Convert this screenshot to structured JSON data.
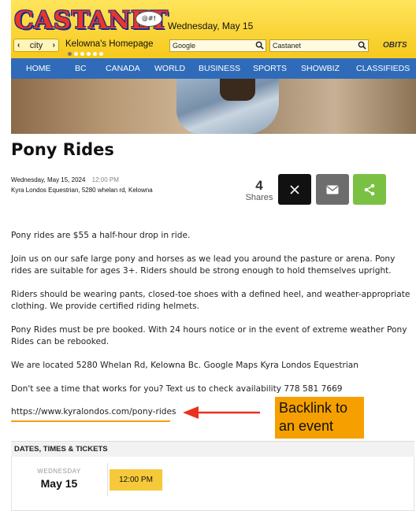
{
  "header": {
    "logo_text": "CASTANET",
    "logo_bubble_text": "@#!",
    "date": "Wednesday, May 15",
    "city_label": "city",
    "home_label": "Kelowna's Homepage",
    "search_google_value": "Google",
    "search_castanet_value": "Castanet",
    "obits_label": "OBITS"
  },
  "nav": {
    "items": [
      "HOME",
      "BC",
      "CANADA",
      "WORLD",
      "BUSINESS",
      "SPORTS",
      "SHOWBIZ",
      "CLASSIFIEDS"
    ]
  },
  "article": {
    "title": "Pony Rides",
    "date": "Wednesday, May 15, 2024",
    "time": "12:00 PM",
    "location": "Kyra Londos Equestrian, 5280 whelan rd, Kelowna",
    "shares_count": "4",
    "shares_label": "Shares",
    "paragraphs": [
      "Pony rides are $55 a half-hour drop in ride.",
      "Join us on our safe large pony and horses as we lead you around the pasture or arena. Pony rides are suitable for ages 3+. Riders should be strong enough to hold themselves upright.",
      "Riders should be wearing pants, closed-toe shoes with a defined heel, and weather-appropriate clothing. We provide certified riding helmets.",
      "Pony Rides must be pre booked. With 24 hours notice or in the event of extreme weather Pony Rides can be rebooked.",
      "We are located 5280 Whelan Rd, Kelowna Bc. Google Maps Kyra Londos Equestrian",
      "Don't see a time that works for you? Text us to check availability 778 581 7669"
    ],
    "link": "https://www.kyralondos.com/pony-rides"
  },
  "annotation": {
    "callout_line1": "Backlink to",
    "callout_line2": "an event"
  },
  "tickets": {
    "heading": "DATES, TIMES & TICKETS",
    "day_of_week": "WEDNESDAY",
    "date": "May 15",
    "time": "12:00 PM"
  },
  "colors": {
    "nav_blue": "#2f6bb8",
    "header_yellow": "#f6c91c",
    "x_share": "#111111",
    "email_share": "#6d6d6d",
    "generic_share": "#7ac143",
    "callout": "#f5a000",
    "arrow": "#e8321e",
    "time_pill": "#f5c93a"
  },
  "icons": {
    "share_x": "x-logo-icon",
    "share_email": "envelope-icon",
    "share_generic": "share-icon",
    "search": "magnifier-icon"
  }
}
